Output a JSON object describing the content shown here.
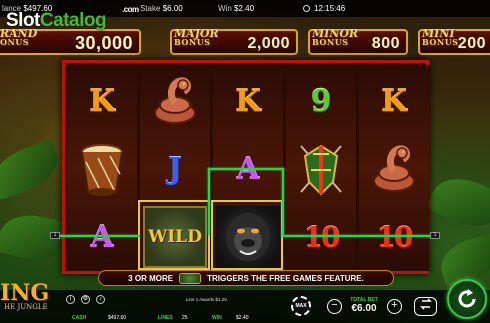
{
  "status": {
    "balance_label": "lance",
    "balance_value": "$497.60",
    "stake_label": "Stake",
    "stake_value": "$6.00",
    "win_label": "Win",
    "win_value": "$2.40",
    "clock": "12:15:46"
  },
  "watermark": {
    "part1": "Slot",
    "part2": "Catalog",
    "suffix": ".com"
  },
  "jackpots": {
    "grand": {
      "name": "RAND",
      "sub": "ONUS",
      "value": "30,000"
    },
    "major": {
      "name": "MAJOR",
      "sub": "BONUS",
      "value": "2,000"
    },
    "minor": {
      "name": "MINOR",
      "sub": "BONUS",
      "value": "800"
    },
    "mini": {
      "name": "MINI",
      "sub": "BONUS",
      "value": "200"
    }
  },
  "reels": [
    [
      "K",
      "drum",
      "A"
    ],
    [
      "snake",
      "J",
      "WILD"
    ],
    [
      "K",
      "A",
      "gorilla"
    ],
    [
      "9",
      "shield",
      "10"
    ],
    [
      "K",
      "snake",
      "10"
    ]
  ],
  "icons": {
    "drum": "drum-icon",
    "snake": "snake-icon",
    "shield": "shield-icon",
    "gorilla": "gorilla-icon"
  },
  "payline": {
    "color": "#2bd24a",
    "left_marker": "1",
    "right_marker": "1",
    "line_label": "1 1"
  },
  "banner": {
    "prefix": "3 OR MORE",
    "suffix": "TRIGGERS THE FREE GAMES FEATURE."
  },
  "logo": {
    "title": "ING",
    "subtitle": "HE JUNGLE"
  },
  "bottom": {
    "line_info": "Line 1 Awards $1.20",
    "cash_label": "CASH",
    "cash_value": "$497.60",
    "lines_label": "LINES",
    "lines_value": "25",
    "win_label": "WIN",
    "win_value": "$2.40",
    "chip_label": "MAX",
    "total_bet_label": "TOTAL BET",
    "total_bet_value": "€6.00",
    "minus": "−",
    "plus": "+"
  },
  "colors": {
    "reel_border": "#b81407",
    "jackpot_gold": "#d8a82a",
    "accent_green": "#47c84a"
  }
}
